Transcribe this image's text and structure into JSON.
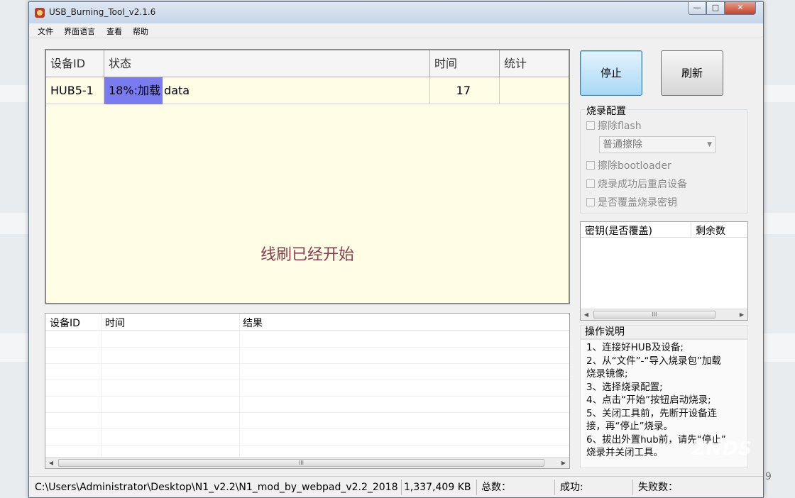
{
  "window": {
    "title": "USB_Burning_Tool_v2.1.6",
    "controls": {
      "minimize": "—",
      "maximize": "□",
      "close": "✕"
    }
  },
  "menu": [
    "文件",
    "界面语言",
    "查看",
    "帮助"
  ],
  "device_table": {
    "columns": [
      "设备ID",
      "状态",
      "时间",
      "统计"
    ],
    "rows": [
      {
        "device_id": "HUB5-1",
        "status": "18%:加载 data",
        "progress": 0.18,
        "time": "17",
        "stats": ""
      }
    ],
    "message": "线刷已经开始"
  },
  "buttons": {
    "stop": "停止",
    "refresh": "刷新"
  },
  "burn_config": {
    "title": "烧录配置",
    "erase_flash": "擦除flash",
    "erase_mode": "普通擦除",
    "erase_bootloader": "擦除bootloader",
    "reboot_after": "烧录成功后重启设备",
    "overwrite_key": "是否覆盖烧录密钥"
  },
  "key_list": {
    "columns": [
      "密钥(是否覆盖)",
      "剩余数"
    ]
  },
  "instructions": {
    "title": "操作说明",
    "lines": [
      "1、连接好HUB及设备;",
      "2、从“文件”-“导入烧录包”加载",
      "烧录镜像;",
      "3、选择烧录配置;",
      "4、点击“开始”按钮启动烧录;",
      "5、关闭工具前，先断开设备连",
      "接，再“停止”烧录。",
      "6、拔出外置hub前，请先“停止”",
      "烧录并关闭工具。"
    ]
  },
  "result_table": {
    "columns": [
      "设备ID",
      "时间",
      "结果"
    ]
  },
  "status_bar": {
    "path": "C:\\Users\\Administrator\\Desktop\\N1_v2.2\\N1_mod_by_webpad_v2.2_2018",
    "size": "1,337,409 KB",
    "total_label": "总数：",
    "success_label": "成功:",
    "fail_label": "失败数："
  },
  "watermark": "ZNDS",
  "edge_digit": "9",
  "colors": {
    "progress": "#7b7bf0",
    "table_bg": "#fffde6",
    "message": "#8a3a4a"
  }
}
